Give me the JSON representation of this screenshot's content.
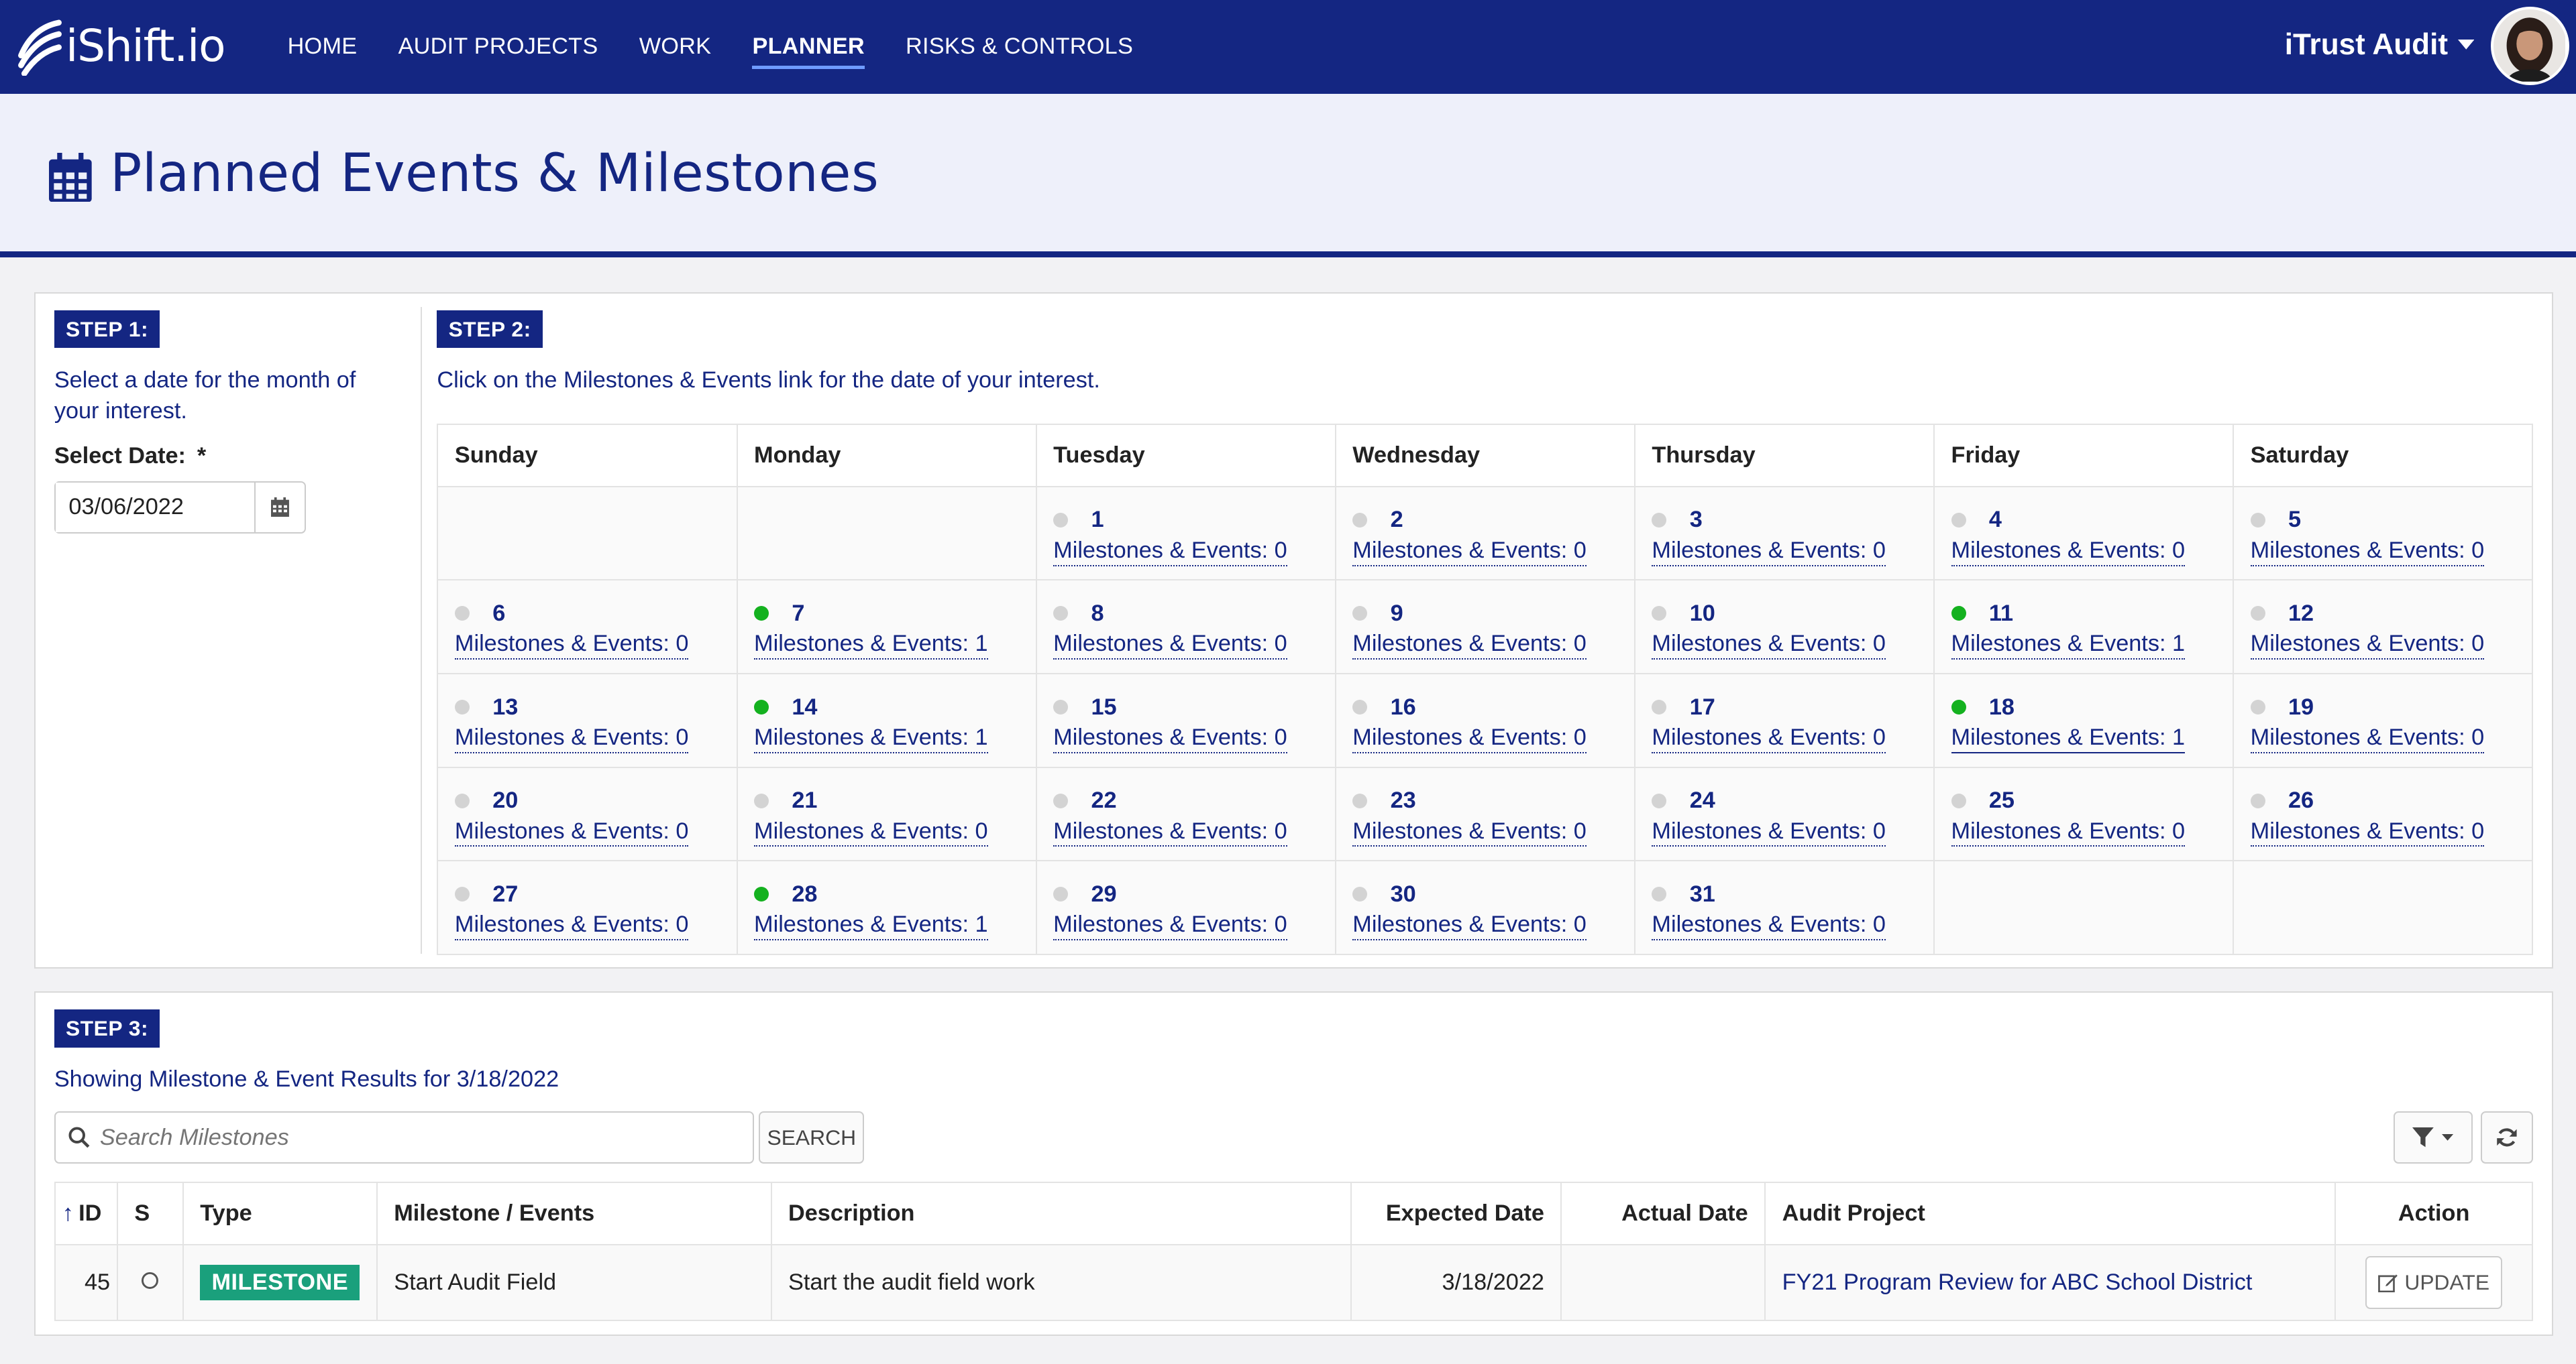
{
  "brand": {
    "name": "iShift.io"
  },
  "nav": {
    "items": [
      "HOME",
      "AUDIT PROJECTS",
      "WORK",
      "PLANNER",
      "RISKS & CONTROLS"
    ],
    "active": "PLANNER"
  },
  "org": {
    "name": "iTrust Audit"
  },
  "page": {
    "title": "Planned Events & Milestones",
    "title_icon": "calendar-icon"
  },
  "step1": {
    "label": "STEP 1:",
    "text": "Select a date for the month of your interest.",
    "date_label": "Select Date:",
    "required": "*",
    "date_value": "03/06/2022"
  },
  "step2": {
    "label": "STEP 2:",
    "text": "Click on the Milestones & Events link for the date of your interest.",
    "weekdays": [
      "Sunday",
      "Monday",
      "Tuesday",
      "Wednesday",
      "Thursday",
      "Friday",
      "Saturday"
    ],
    "link_prefix": "Milestones & Events: ",
    "weeks": [
      [
        null,
        null,
        {
          "day": "1",
          "count": "0"
        },
        {
          "day": "2",
          "count": "0"
        },
        {
          "day": "3",
          "count": "0"
        },
        {
          "day": "4",
          "count": "0"
        },
        {
          "day": "5",
          "count": "0"
        }
      ],
      [
        {
          "day": "6",
          "count": "0"
        },
        {
          "day": "7",
          "count": "1"
        },
        {
          "day": "8",
          "count": "0"
        },
        {
          "day": "9",
          "count": "0"
        },
        {
          "day": "10",
          "count": "0"
        },
        {
          "day": "11",
          "count": "1"
        },
        {
          "day": "12",
          "count": "0"
        }
      ],
      [
        {
          "day": "13",
          "count": "0"
        },
        {
          "day": "14",
          "count": "1"
        },
        {
          "day": "15",
          "count": "0"
        },
        {
          "day": "16",
          "count": "0"
        },
        {
          "day": "17",
          "count": "0"
        },
        {
          "day": "18",
          "count": "1",
          "selected": true
        },
        {
          "day": "19",
          "count": "0"
        }
      ],
      [
        {
          "day": "20",
          "count": "0"
        },
        {
          "day": "21",
          "count": "0"
        },
        {
          "day": "22",
          "count": "0"
        },
        {
          "day": "23",
          "count": "0"
        },
        {
          "day": "24",
          "count": "0"
        },
        {
          "day": "25",
          "count": "0"
        },
        {
          "day": "26",
          "count": "0"
        }
      ],
      [
        {
          "day": "27",
          "count": "0"
        },
        {
          "day": "28",
          "count": "1"
        },
        {
          "day": "29",
          "count": "0"
        },
        {
          "day": "30",
          "count": "0"
        },
        {
          "day": "31",
          "count": "0"
        },
        null,
        null
      ]
    ]
  },
  "step3": {
    "label": "STEP 3:",
    "text": "Showing Milestone & Event Results for 3/18/2022",
    "search_placeholder": "Search Milestones",
    "search_button": "SEARCH",
    "columns": [
      "ID",
      "S",
      "Type",
      "Milestone / Events",
      "Description",
      "Expected Date",
      "Actual Date",
      "Audit Project",
      "Action"
    ],
    "rows": [
      {
        "id": "45",
        "type": "MILESTONE",
        "name": "Start Audit Field",
        "description": "Start the audit field work",
        "expected": "3/18/2022",
        "actual": "",
        "project": "FY21 Program Review for ABC School District",
        "action": "UPDATE"
      }
    ]
  },
  "colors": {
    "navy": "#142682",
    "active_dot": "#14b11f",
    "badge": "#1aa07c"
  }
}
